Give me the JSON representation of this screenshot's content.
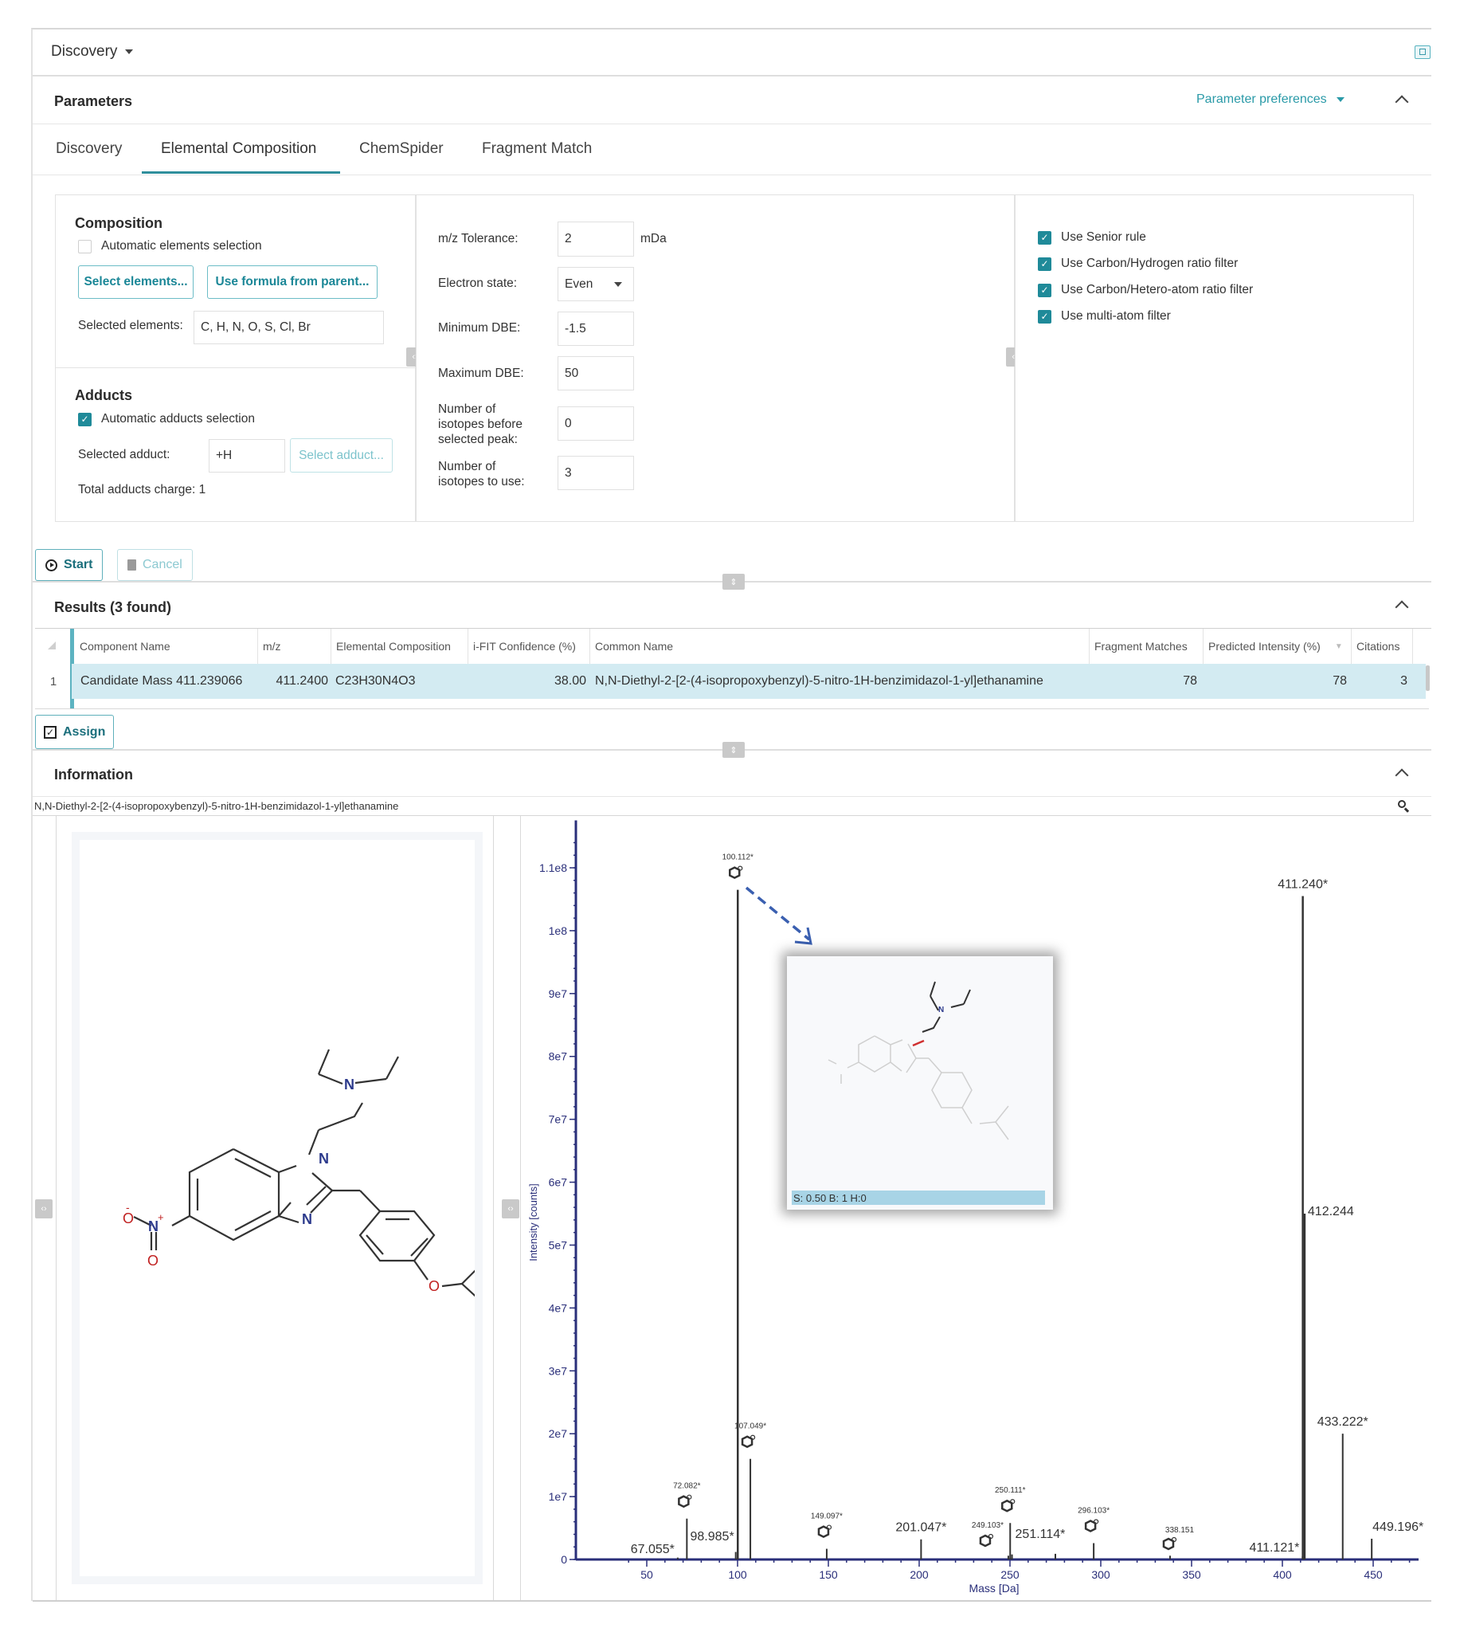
{
  "workspace": {
    "title": "Discovery",
    "panel_icon": "panel-toggle-icon"
  },
  "parameters": {
    "title": "Parameters",
    "preferences_label": "Parameter preferences",
    "tabs": [
      {
        "label": "Discovery",
        "active": false
      },
      {
        "label": "Elemental Composition",
        "active": true
      },
      {
        "label": "ChemSpider",
        "active": false
      },
      {
        "label": "Fragment Match",
        "active": false
      }
    ],
    "composition": {
      "title": "Composition",
      "auto_elements_label": "Automatic elements selection",
      "auto_elements_checked": false,
      "select_elements_button": "Select elements...",
      "use_formula_button": "Use formula from parent...",
      "selected_elements_label": "Selected elements:",
      "selected_elements_value": "C, H, N, O, S, Cl, Br"
    },
    "adducts": {
      "title": "Adducts",
      "auto_adducts_label": "Automatic adducts selection",
      "auto_adducts_checked": true,
      "selected_adduct_label": "Selected adduct:",
      "selected_adduct_value": "+H",
      "select_adduct_button": "Select adduct...",
      "total_charge_label": "Total adducts charge: 1"
    },
    "settings": {
      "mz_tolerance_label": "m/z Tolerance:",
      "mz_tolerance_value": "2",
      "mz_tolerance_unit": "mDa",
      "electron_state_label": "Electron state:",
      "electron_state_value": "Even",
      "min_dbe_label": "Minimum DBE:",
      "min_dbe_value": "-1.5",
      "max_dbe_label": "Maximum DBE:",
      "max_dbe_value": "50",
      "isotopes_before_label": "Number of isotopes before selected peak:",
      "isotopes_before_value": "0",
      "isotopes_use_label": "Number of isotopes to use:",
      "isotopes_use_value": "3"
    },
    "filters": [
      {
        "label": "Use Senior rule",
        "checked": true
      },
      {
        "label": "Use Carbon/Hydrogen ratio filter",
        "checked": true
      },
      {
        "label": "Use Carbon/Hetero-atom ratio filter",
        "checked": true
      },
      {
        "label": "Use multi-atom filter",
        "checked": true
      }
    ]
  },
  "actions": {
    "start_label": "Start",
    "cancel_label": "Cancel",
    "assign_label": "Assign"
  },
  "results": {
    "title": "Results (3 found)",
    "columns": [
      "Component Name",
      "m/z",
      "Elemental Composition",
      "i-FIT Confidence (%)",
      "Common Name",
      "Fragment Matches",
      "Predicted Intensity (%)",
      "Citations"
    ],
    "rows": [
      {
        "index": "1",
        "component_name": "Candidate Mass 411.239066",
        "mz": "411.2400",
        "elemental_composition": "C23H30N4O3",
        "ifit_confidence": "38.00",
        "common_name": "N,N-Diethyl-2-[2-(4-isopropoxybenzyl)-5-nitro-1H-benzimidazol-1-yl]ethanamine",
        "fragment_matches": "78",
        "predicted_intensity": "78",
        "citations": "3"
      }
    ]
  },
  "information": {
    "title": "Information",
    "compound_name": "N,N-Diethyl-2-[2-(4-isopropoxybenzyl)-5-nitro-1H-benzimidazol-1-yl]ethanamine",
    "structure_atoms": {
      "n1": "N",
      "n2": "N",
      "n3": "N",
      "o1": "O",
      "o2": "O",
      "o3": "O",
      "nitro_n": "N",
      "plus": "+",
      "minus": "-"
    },
    "inset_caption": "S: 0.50 B: 1 H:0"
  },
  "chart_data": {
    "type": "bar",
    "subtype": "mass-spectrum-stick",
    "xlabel": "Mass [Da]",
    "ylabel": "Intensity [counts]",
    "xlim": [
      30,
      475
    ],
    "ylim": [
      0,
      115000000.0
    ],
    "x_ticks": [
      50,
      100,
      150,
      200,
      250,
      300,
      350,
      400,
      450
    ],
    "y_ticks": [
      {
        "value": 0,
        "label": "0"
      },
      {
        "value": 10000000.0,
        "label": "1e7"
      },
      {
        "value": 20000000.0,
        "label": "2e7"
      },
      {
        "value": 30000000.0,
        "label": "3e7"
      },
      {
        "value": 40000000.0,
        "label": "4e7"
      },
      {
        "value": 50000000.0,
        "label": "5e7"
      },
      {
        "value": 60000000.0,
        "label": "6e7"
      },
      {
        "value": 70000000.0,
        "label": "7e7"
      },
      {
        "value": 80000000.0,
        "label": "8e7"
      },
      {
        "value": 90000000.0,
        "label": "9e7"
      },
      {
        "value": 100000000.0,
        "label": "1e8"
      },
      {
        "value": 110000000.0,
        "label": "1.1e8"
      }
    ],
    "peaks": [
      {
        "mz": 67.055,
        "intensity": 300000.0,
        "label": "67.055*",
        "fragment_icon": false,
        "label_size": "large"
      },
      {
        "mz": 72.082,
        "intensity": 6500000.0,
        "label": "72.082*",
        "fragment_icon": true,
        "label_size": "small"
      },
      {
        "mz": 98.985,
        "intensity": 1200000.0,
        "label": "98.985*",
        "fragment_icon": false,
        "label_size": "large"
      },
      {
        "mz": 100.112,
        "intensity": 106500000.0,
        "label": "100.112*",
        "fragment_icon": true,
        "label_size": "small"
      },
      {
        "mz": 107.049,
        "intensity": 16000000.0,
        "label": "107.049*",
        "fragment_icon": true,
        "label_size": "small"
      },
      {
        "mz": 149.097,
        "intensity": 1700000.0,
        "label": "149.097*",
        "fragment_icon": true,
        "label_size": "small"
      },
      {
        "mz": 201.047,
        "intensity": 3200000.0,
        "label": "201.047*",
        "fragment_icon": false,
        "label_size": "large"
      },
      {
        "mz": 249.103,
        "intensity": 600000.0,
        "label": "249.103*",
        "fragment_icon": true,
        "label_size": "small"
      },
      {
        "mz": 250.111,
        "intensity": 5800000.0,
        "label": "250.111*",
        "fragment_icon": true,
        "label_size": "small"
      },
      {
        "mz": 251.114,
        "intensity": 800000.0,
        "label": "251.114*",
        "fragment_icon": false,
        "label_size": "large"
      },
      {
        "mz": 275.0,
        "intensity": 900000.0,
        "label": "",
        "fragment_icon": false,
        "label_size": "none"
      },
      {
        "mz": 296.103,
        "intensity": 2600000.0,
        "label": "296.103*",
        "fragment_icon": true,
        "label_size": "small"
      },
      {
        "mz": 338.151,
        "intensity": 600000.0,
        "label": "338.151",
        "fragment_icon": true,
        "label_size": "small"
      },
      {
        "mz": 411.121,
        "intensity": 500000.0,
        "label": "411.121*",
        "fragment_icon": false,
        "label_size": "large"
      },
      {
        "mz": 411.24,
        "intensity": 105500000.0,
        "label": "411.240*",
        "fragment_icon": false,
        "label_size": "large"
      },
      {
        "mz": 412.244,
        "intensity": 55000000.0,
        "label": "412.244",
        "fragment_icon": false,
        "label_size": "large"
      },
      {
        "mz": 433.222,
        "intensity": 20000000.0,
        "label": "433.222*",
        "fragment_icon": false,
        "label_size": "large"
      },
      {
        "mz": 449.196,
        "intensity": 3300000.0,
        "label": "449.196*",
        "fragment_icon": false,
        "label_size": "large"
      }
    ],
    "annotation": {
      "from_peak": "100.112*",
      "type": "dashed-arrow-to-inset"
    },
    "colors": {
      "axis": "#2a2f7a",
      "peak": "#333333",
      "arrow": "#3a5fb0"
    }
  }
}
